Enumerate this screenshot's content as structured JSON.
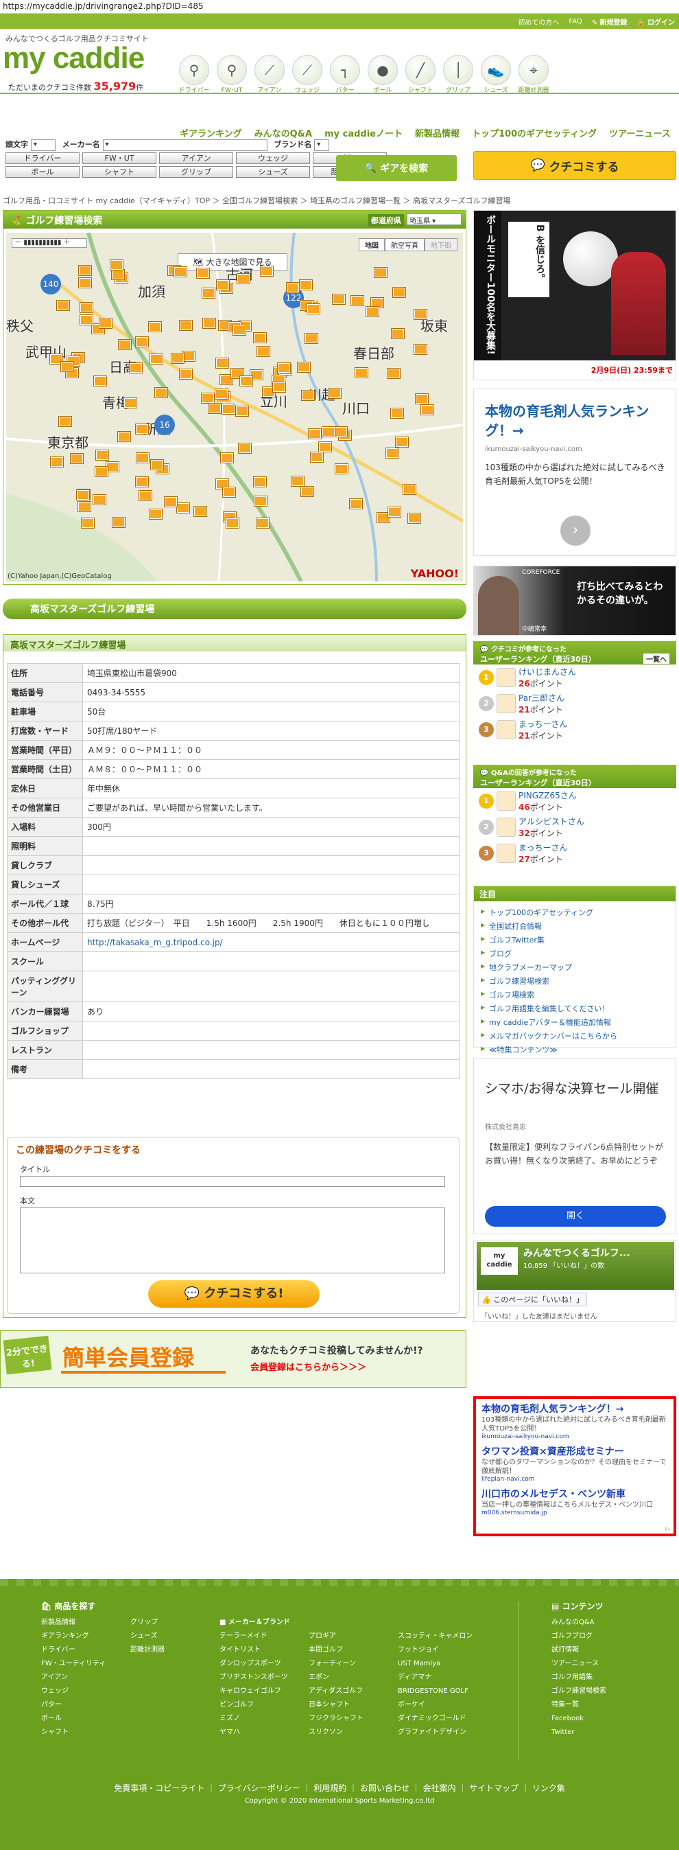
{
  "url": "https://mycaddie.jp/drivingrange2.php?DID=485",
  "topbar": {
    "beginner": "初めての方へ",
    "faq": "FAQ",
    "register": "新規登録",
    "login": "ログイン"
  },
  "logo": {
    "tagline": "みんなでつくるゴルフ用品クチコミサイト",
    "name": "my caddie",
    "count_label": "ただいまのクチコミ件数",
    "count_value": "35,979",
    "count_unit": "件"
  },
  "categories": [
    {
      "label": "ドライバー",
      "icon": "driver-icon"
    },
    {
      "label": "FW･UT",
      "icon": "fairway-wood-icon"
    },
    {
      "label": "アイアン",
      "icon": "iron-icon"
    },
    {
      "label": "ウェッジ",
      "icon": "wedge-icon"
    },
    {
      "label": "パター",
      "icon": "putter-icon"
    },
    {
      "label": "ボール",
      "icon": "ball-icon"
    },
    {
      "label": "シャフト",
      "icon": "shaft-icon"
    },
    {
      "label": "グリップ",
      "icon": "grip-icon"
    },
    {
      "label": "シューズ",
      "icon": "shoes-icon"
    },
    {
      "label": "距離計測器",
      "icon": "rangefinder-icon"
    }
  ],
  "mainnav": [
    "ギアランキング",
    "みんなのQ&A",
    "my caddieノート",
    "新製品情報",
    "トップ100のギアセッティング",
    "ツアーニュース"
  ],
  "search": {
    "head_letter": "頭文字",
    "maker": "メーカー名",
    "brand": "ブランド名",
    "buttons": [
      "ドライバー",
      "FW・UT",
      "アイアン",
      "ウェッジ",
      "パター",
      "ボール",
      "シャフト",
      "グリップ",
      "シューズ",
      "距離計測器"
    ],
    "gear_search": "ギアを検索",
    "kuchikomi": "クチコミする"
  },
  "breadcrumb": "ゴルフ用品・口コミサイト my caddie（マイキャディ）TOP ＞ 全国ゴルフ練習場検索 ＞ 埼玉県のゴルフ練習場一覧 ＞ 高坂マスターズゴルフ練習場",
  "map": {
    "title": "ゴルフ練習場検索",
    "pref_label": "都道府県",
    "pref_value": "埼玉県",
    "big_map": "大きな地図で見る",
    "type_map": "地図",
    "type_photo": "航空写真",
    "type_terrain": "地下街",
    "places": [
      "加須",
      "古河",
      "坂東",
      "春日部",
      "武甲山",
      "日高",
      "青梅",
      "東京都",
      "所沢",
      "立川",
      "川越",
      "川口",
      "秩父"
    ],
    "roads": [
      "140",
      "122",
      "16"
    ],
    "copyright": "(C)Yahoo Japan,(C)GeoCatalog",
    "yahoo": "YAHOO!"
  },
  "facility": {
    "name": "高坂マスターズゴルフ練習場",
    "rows": [
      [
        "住所",
        "埼玉県東松山市葛袋900"
      ],
      [
        "電話番号",
        "0493-34-5555"
      ],
      [
        "駐車場",
        "50台"
      ],
      [
        "打席数・ヤード",
        "50打席/180ヤード"
      ],
      [
        "営業時間（平日）",
        "ＡＭ９：００～ＰＭ１１：００"
      ],
      [
        "営業時間（土日）",
        "ＡＭ８：００～ＰＭ１１：００"
      ],
      [
        "定休日",
        "年中無休"
      ],
      [
        "その他営業日",
        "ご要望があれば、早い時間から営業いたします。"
      ],
      [
        "入場料",
        "300円"
      ],
      [
        "照明料",
        ""
      ],
      [
        "貸しクラブ",
        ""
      ],
      [
        "貸しシューズ",
        ""
      ],
      [
        "ボール代／１球",
        "8.75円"
      ],
      [
        "その他ボール代",
        "打ち放題（ビジター）　平日　　1.5h 1600円　　2.5h 1900円　　休日ともに１００円増し"
      ],
      [
        "ホームページ",
        "http://takasaka_m_g.tripod.co.jp/"
      ],
      [
        "スクール",
        ""
      ],
      [
        "パッティンググリーン",
        ""
      ],
      [
        "バンカー練習場",
        "あり"
      ],
      [
        "ゴルフショップ",
        ""
      ],
      [
        "レストラン",
        ""
      ],
      [
        "備考",
        ""
      ]
    ]
  },
  "review": {
    "title": "この練習場のクチコミをする",
    "title_label": "タイトル",
    "body_label": "本文",
    "submit": "クチコミする!"
  },
  "signup": {
    "badge": "2分でできる!",
    "title": "簡単会員登録",
    "lead": "あなたもクチコミ投稿してみませんか!?",
    "link": "会員登録はこちらから＞＞＞"
  },
  "ads": {
    "ball": {
      "headline": "ボールモニター100名を大募集!",
      "brand": "B を信じろ。",
      "date": "2月9日(日)",
      "time": "23:59まで"
    },
    "hair": {
      "title": "本物の育毛剤人気ランキング！→",
      "url": "ikumouzai-saikyou-navi.com",
      "body": "103種類の中から選ばれた絶対に試してみるべき育毛剤最新人気TOP5を公開！"
    },
    "coreforce": {
      "brand": "COREFORCE",
      "copy": "打ち比べてみるとわかるその違いが。",
      "name": "中嶋常幸"
    },
    "shimaho": {
      "title": "シマホ/お得な決算セール開催",
      "company": "株式会社島忠",
      "body": "【数量限定】便利なフライパン6点特別セットがお買い得！無くなり次第終了、お早めにどうぞ",
      "button": "開く"
    },
    "text_ads": [
      {
        "title": "本物の育毛剤人気ランキング！→",
        "body": "103種類の中から選ばれた絶対に試してみるべき育毛剤最新人気TOP5を公開！",
        "url": "ikumouzai-saikyou-navi.com"
      },
      {
        "title": "タワマン投資×資産形成セミナー",
        "body": "なぜ都心のタワーマンションなのか？その理由をセミナーで徹底解説！",
        "url": "lifeplan-navi.com"
      },
      {
        "title": "川口市のメルセデス・ベンツ新車",
        "body": "当店一押しの車種情報はこちらメルセデス・ベンツ川口",
        "url": "m006.sternsumida.jp"
      }
    ]
  },
  "rank1": {
    "title": "クチコミが参考になった",
    "subtitle": "ユーザーランキング（直近30日）",
    "more": "一覧へ",
    "items": [
      {
        "name": "けいじまんさん",
        "pts": "26"
      },
      {
        "name": "Par三郎さん",
        "pts": "21"
      },
      {
        "name": "まっちーさん",
        "pts": "21"
      }
    ]
  },
  "rank2": {
    "title": "Q&Aの回答が参考になった",
    "subtitle": "ユーザーランキング（直近30日）",
    "items": [
      {
        "name": "PINGZZ65さん",
        "pts": "46"
      },
      {
        "name": "アルシビストさん",
        "pts": "32"
      },
      {
        "name": "まっちーさん",
        "pts": "27"
      }
    ]
  },
  "points_unit": "ポイント",
  "attention": {
    "title": "注目",
    "links": [
      "トップ100のギアセッティング",
      "全国試打会情報",
      "ゴルフTwitter集",
      "ブログ",
      "地クラブメーカーマップ",
      "ゴルフ練習場検索",
      "ゴルフ場検索",
      "ゴルフ用語集を編集してください！",
      "my caddieアバター＆機能追加情報",
      "メルマガバックナンバーはこちらから",
      "≪特集コンテンツ≫"
    ]
  },
  "fb": {
    "title": "みんなでつくるゴルフ...",
    "likes": "10,859 「いいね！」の数",
    "button": "このページに「いいね！」",
    "note": "「いいね！」した友達はまだいません"
  },
  "footer": {
    "products_title": "商品を探す",
    "col1": [
      "新製品情報",
      "ギアランキング",
      "ドライバー",
      "FW・ユーティリティ",
      "アイアン",
      "ウェッジ",
      "パター",
      "ボール",
      "シャフト"
    ],
    "col2": [
      "グリップ",
      "シューズ",
      "距離計測器"
    ],
    "maker_title": "メーカー＆ブランド",
    "col3": [
      "テーラーメイド",
      "タイトリスト",
      "ダンロップスポーツ",
      "ブリヂストンスポーツ",
      "キャロウェイゴルフ",
      "ピンゴルフ",
      "ミズノ",
      "ヤマハ"
    ],
    "col4": [
      "プロギア",
      "本間ゴルフ",
      "フォーティーン",
      "エポン",
      "アディダスゴルフ",
      "日本シャフト",
      "フジクラシャフト",
      "スリクソン"
    ],
    "col5": [
      "スコッティ・キャメロン",
      "フットジョイ",
      "UST Mamiya",
      "ディアマナ",
      "BRIDGESTONE GOLF",
      "ボーケイ",
      "ダイナミックゴールド",
      "グラファイトデザイン"
    ],
    "contents_title": "コンテンツ",
    "col6": [
      "みんなのQ&A",
      "ゴルフブログ",
      "試打情報",
      "ツアーニュース",
      "ゴルフ用語集",
      "ゴルフ練習場検索",
      "特集一覧",
      "Facebook",
      "Twitter"
    ],
    "bottom_links": "免責事項・コピーライト ｜ プライバシーポリシー ｜ 利用規約 ｜ お問い合わせ ｜ 会社案内 ｜ サイトマップ ｜ リンク集",
    "copyright": "Copyright © 2020 International Sports Marketing,co.ltd"
  }
}
